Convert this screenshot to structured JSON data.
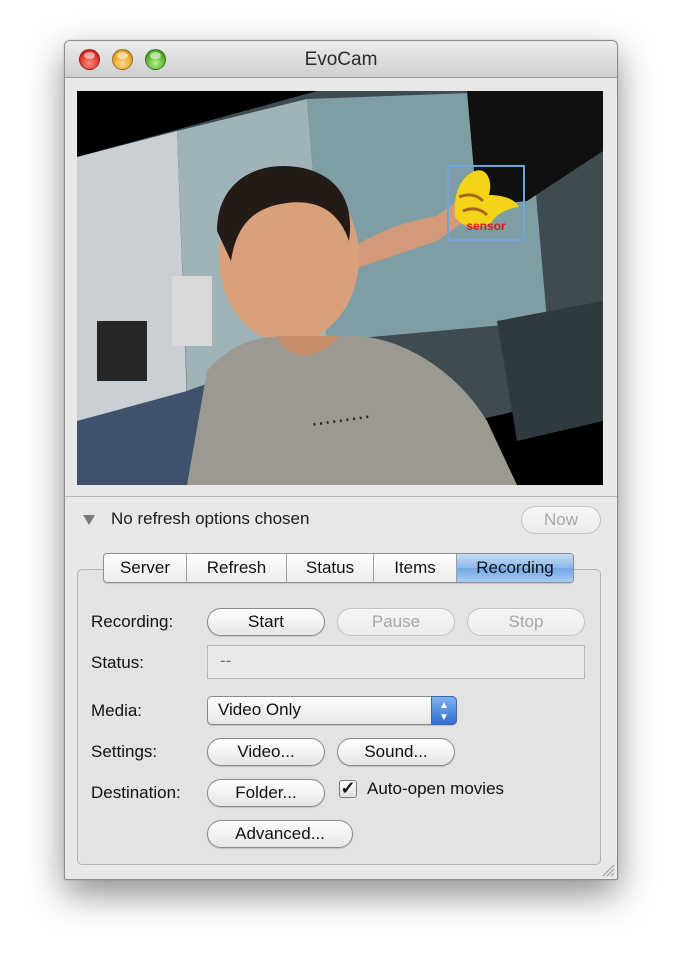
{
  "window": {
    "title": "EvoCam"
  },
  "video": {
    "sensor_label": "sensor"
  },
  "refresh": {
    "text": "No refresh options chosen",
    "now_label": "Now"
  },
  "tabs": [
    {
      "label": "Server",
      "selected": false
    },
    {
      "label": "Refresh",
      "selected": false
    },
    {
      "label": "Status",
      "selected": false
    },
    {
      "label": "Items",
      "selected": false
    },
    {
      "label": "Recording",
      "selected": true
    }
  ],
  "recording": {
    "recording_label": "Recording:",
    "start_label": "Start",
    "pause_label": "Pause",
    "stop_label": "Stop",
    "status_label": "Status:",
    "status_value": "--",
    "media_label": "Media:",
    "media_value": "Video Only",
    "settings_label": "Settings:",
    "video_button": "Video...",
    "sound_button": "Sound...",
    "destination_label": "Destination:",
    "folder_button": "Folder...",
    "auto_open_label": "Auto-open movies",
    "auto_open_checked": true,
    "advanced_button": "Advanced..."
  },
  "colors": {
    "selected_tab": "#8cb8ea",
    "sensor_border": "#6fa5df",
    "sensor_text": "#e01818"
  }
}
